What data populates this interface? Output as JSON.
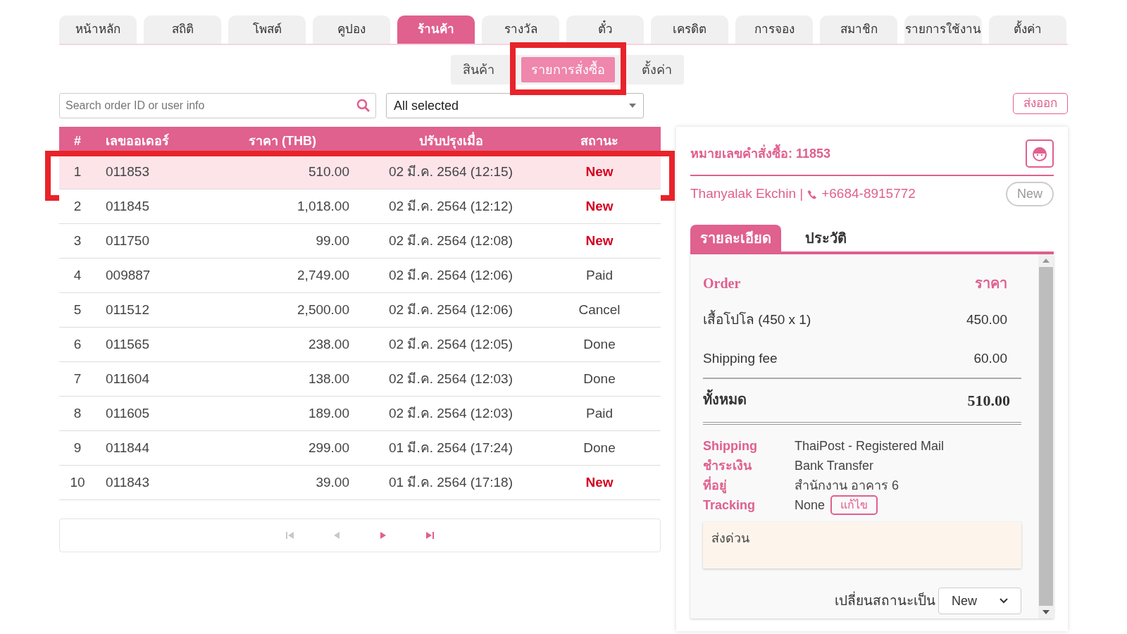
{
  "tabs": [
    {
      "label": "หน้าหลัก",
      "selected": false
    },
    {
      "label": "สถิติ",
      "selected": false
    },
    {
      "label": "โพสต์",
      "selected": false
    },
    {
      "label": "คูปอง",
      "selected": false
    },
    {
      "label": "ร้านค้า",
      "selected": true
    },
    {
      "label": "รางวัล",
      "selected": false
    },
    {
      "label": "ตั๋ว",
      "selected": false
    },
    {
      "label": "เครดิต",
      "selected": false
    },
    {
      "label": "การจอง",
      "selected": false
    },
    {
      "label": "สมาชิก",
      "selected": false
    },
    {
      "label": "รายการใช้งาน",
      "selected": false
    },
    {
      "label": "ตั้งค่า",
      "selected": false
    }
  ],
  "subtabs": [
    {
      "label": "สินค้า",
      "selected": false,
      "callout": false
    },
    {
      "label": "รายการสั่งซื้อ",
      "selected": true,
      "callout": true
    },
    {
      "label": "ตั้งค่า",
      "selected": false,
      "callout": false
    }
  ],
  "search": {
    "placeholder": "Search order ID or user info"
  },
  "filter": {
    "value": "All selected"
  },
  "export_button": "ส่งออก",
  "table": {
    "columns": [
      "#",
      "เลขออเดอร์",
      "ราคา (THB)",
      "ปรับปรุงเมื่อ",
      "สถานะ"
    ],
    "rows": [
      {
        "cells": [
          "1",
          "011853",
          "510.00",
          "02 มี.ค. 2564 (12:15)",
          "New"
        ],
        "status_new": true,
        "selected": true,
        "callout": true
      },
      {
        "cells": [
          "2",
          "011845",
          "1,018.00",
          "02 มี.ค. 2564 (12:12)",
          "New"
        ],
        "status_new": true,
        "selected": false,
        "callout": false
      },
      {
        "cells": [
          "3",
          "011750",
          "99.00",
          "02 มี.ค. 2564 (12:08)",
          "New"
        ],
        "status_new": true,
        "selected": false,
        "callout": false
      },
      {
        "cells": [
          "4",
          "009887",
          "2,749.00",
          "02 มี.ค. 2564 (12:06)",
          "Paid"
        ],
        "status_new": false,
        "selected": false,
        "callout": false
      },
      {
        "cells": [
          "5",
          "011512",
          "2,500.00",
          "02 มี.ค. 2564 (12:06)",
          "Cancel"
        ],
        "status_new": false,
        "selected": false,
        "callout": false
      },
      {
        "cells": [
          "6",
          "011565",
          "238.00",
          "02 มี.ค. 2564 (12:05)",
          "Done"
        ],
        "status_new": false,
        "selected": false,
        "callout": false
      },
      {
        "cells": [
          "7",
          "011604",
          "138.00",
          "02 มี.ค. 2564 (12:03)",
          "Done"
        ],
        "status_new": false,
        "selected": false,
        "callout": false
      },
      {
        "cells": [
          "8",
          "011605",
          "189.00",
          "02 มี.ค. 2564 (12:03)",
          "Paid"
        ],
        "status_new": false,
        "selected": false,
        "callout": false
      },
      {
        "cells": [
          "9",
          "011844",
          "299.00",
          "01 มี.ค. 2564 (17:24)",
          "Done"
        ],
        "status_new": false,
        "selected": false,
        "callout": false
      },
      {
        "cells": [
          "10",
          "011843",
          "39.00",
          "01 มี.ค. 2564 (17:18)",
          "New"
        ],
        "status_new": true,
        "selected": false,
        "callout": false
      }
    ]
  },
  "pager": [
    {
      "kind": "first",
      "disabled": true
    },
    {
      "kind": "prev",
      "disabled": true
    },
    {
      "kind": "next",
      "disabled": false
    },
    {
      "kind": "last",
      "disabled": false
    }
  ],
  "detail": {
    "title": "หมายเลขคำสั่งซื้อ: 11853",
    "customer": "Thanyalak Ekchin |",
    "phone": "+6684-8915772",
    "status_badge": "New",
    "tabs": [
      {
        "label": "รายละเอียด",
        "selected": true
      },
      {
        "label": "ประวัติ",
        "selected": false
      }
    ],
    "order_header": [
      "Order",
      "ราคา"
    ],
    "items": [
      {
        "name": "เสื้อโปโล (450 x 1)",
        "price": "450.00"
      },
      {
        "name": "Shipping fee",
        "price": "60.00"
      }
    ],
    "total_label": "ทั้งหมด",
    "total": "510.00",
    "info": [
      {
        "label": "Shipping",
        "value": "ThaiPost - Registered Mail"
      },
      {
        "label": "ชำระเงิน",
        "value": "Bank Transfer"
      },
      {
        "label": "ที่อยู่",
        "value": "สำนักงาน อาคาร 6"
      },
      {
        "label": "Tracking",
        "value": "None",
        "edit_button": "แก้ไข"
      }
    ],
    "note": "ส่งด่วน",
    "change_status_label": "เปลี่ยนสถานะเป็น",
    "change_status_value": "New"
  }
}
